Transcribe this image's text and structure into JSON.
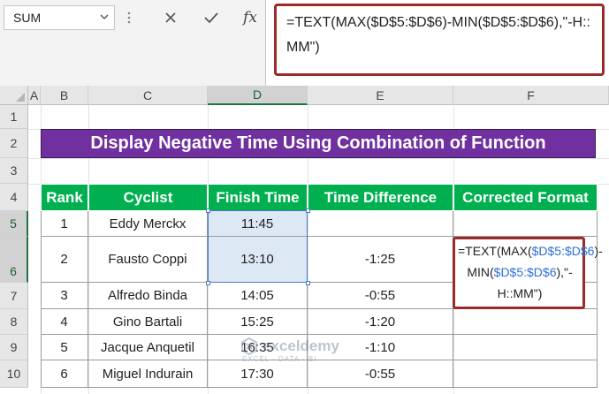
{
  "name_box": {
    "value": "SUM"
  },
  "formula_bar": {
    "fx_label": "fx",
    "formula": "=TEXT(MAX($D$5:$D$6)-MIN($D$5:$D$6),\"-H::MM\")"
  },
  "columns": [
    "A",
    "B",
    "C",
    "D",
    "E",
    "F"
  ],
  "rows": [
    "1",
    "2",
    "3",
    "4",
    "5",
    "6",
    "7",
    "8",
    "9",
    "10"
  ],
  "banner": {
    "title": "Display Negative Time Using Combination of Function"
  },
  "table": {
    "headers": [
      "Rank",
      "Cyclist",
      "Finish Time",
      "Time Difference",
      "Corrected Format"
    ],
    "rows": [
      {
        "rank": "1",
        "cyclist": "Eddy Merckx",
        "finish": "11:45",
        "diff": ""
      },
      {
        "rank": "2",
        "cyclist": "Fausto Coppi",
        "finish": "13:10",
        "diff": "-1:25"
      },
      {
        "rank": "3",
        "cyclist": "Alfredo Binda",
        "finish": "14:05",
        "diff": "-0:55"
      },
      {
        "rank": "4",
        "cyclist": "Gino Bartali",
        "finish": "15:25",
        "diff": "-1:20"
      },
      {
        "rank": "5",
        "cyclist": "Jacque Anquetil",
        "finish": "16:35",
        "diff": "-1:10"
      },
      {
        "rank": "6",
        "cyclist": "Miguel Indurain",
        "finish": "17:30",
        "diff": "-0:55"
      }
    ]
  },
  "edit_cell": {
    "p1": "=TEXT(MAX(",
    "r1": "$D$5:",
    "r2": "$D$6",
    "p2": ")-MIN(",
    "r3": "$D$5:",
    "r4": "$D$6",
    "p3": "),\"-H::MM\")"
  },
  "watermark": {
    "name": "exceldemy",
    "tagline": "EXCEL · DATA · BI"
  },
  "colors": {
    "banner": "#7030a0",
    "header": "#00b050",
    "highlight": "#9b2b2b",
    "reference": "#2f6fd6",
    "selection": "#dde8f5"
  }
}
